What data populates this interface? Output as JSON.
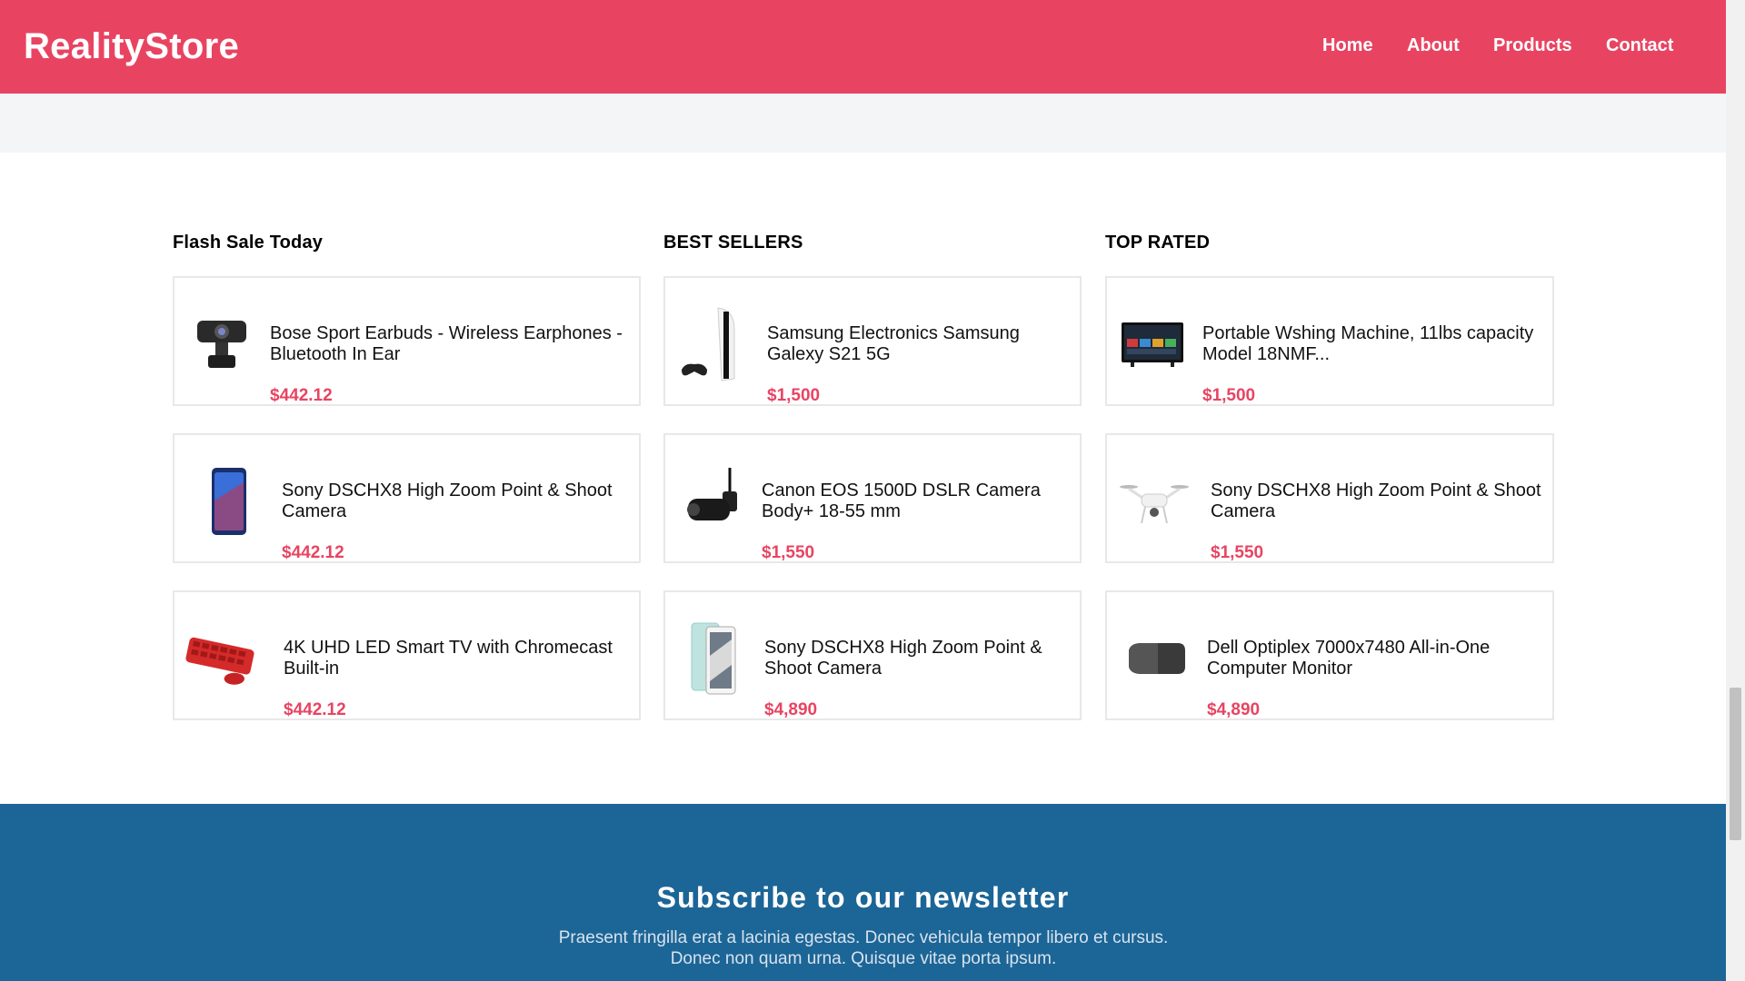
{
  "header": {
    "logo": "RealityStore",
    "nav": [
      "Home",
      "About",
      "Products",
      "Contact"
    ]
  },
  "columns": [
    {
      "title": "Flash Sale Today",
      "items": [
        {
          "name": "Bose Sport Earbuds - Wireless Earphones - Bluetooth In Ear",
          "price": "$442.12",
          "icon": "webcam-icon"
        },
        {
          "name": "Sony DSCHX8 High Zoom Point & Shoot Camera",
          "price": "$442.12",
          "icon": "smartphone-icon"
        },
        {
          "name": "4K UHD LED Smart TV with Chromecast Built-in",
          "price": "$442.12",
          "icon": "keyboard-mouse-icon"
        }
      ]
    },
    {
      "title": "BEST SELLERS",
      "items": [
        {
          "name": "Samsung Electronics Samsung Galexy S21 5G",
          "price": "$1,500",
          "icon": "game-console-icon"
        },
        {
          "name": "Canon EOS 1500D DSLR Camera Body+ 18-55 mm",
          "price": "$1,550",
          "icon": "security-camera-icon"
        },
        {
          "name": "Sony DSCHX8 High Zoom Point & Shoot Camera",
          "price": "$4,890",
          "icon": "smartphone-icon"
        }
      ]
    },
    {
      "title": "TOP RATED",
      "items": [
        {
          "name": "Portable Wshing Machine, 11lbs capacity Model 18NMF...",
          "price": "$1,500",
          "icon": "television-icon"
        },
        {
          "name": "Sony DSCHX8 High Zoom Point & Shoot Camera",
          "price": "$1,550",
          "icon": "drone-icon"
        },
        {
          "name": "Dell Optiplex 7000x7480 All-in-One Computer Monitor",
          "price": "$4,890",
          "icon": "speaker-icon"
        }
      ]
    }
  ],
  "newsletter": {
    "title": "Subscribe to our newsletter",
    "text": "Praesent fringilla erat a lacinia egestas. Donec vehicula tempor libero et cursus. Donec non quam urna. Quisque vitae porta ipsum."
  },
  "colors": {
    "brand": "#e84462",
    "footer": "#1c6597",
    "price": "#e84462"
  }
}
